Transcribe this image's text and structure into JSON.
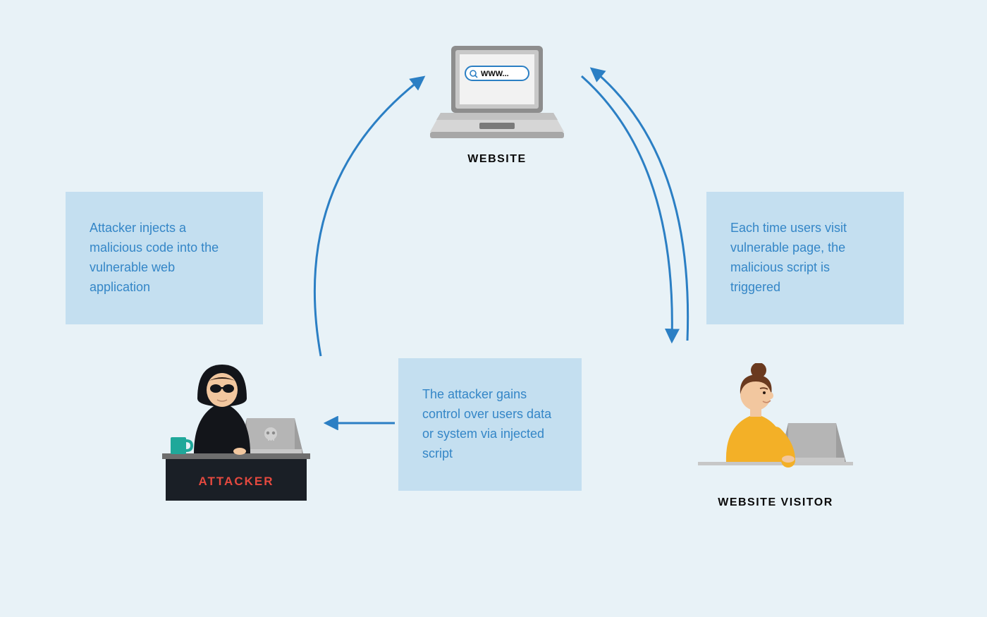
{
  "nodes": {
    "website_label": "WEBSITE",
    "website_url": "WWW...",
    "attacker_label": "ATTACKER",
    "visitor_label": "WEBSITE VISITOR"
  },
  "boxes": {
    "attacker_injects": "Attacker injects a malicious code into the vulnerable web application",
    "visitor_triggers": "Each time users visit vulnerable page, the malicious script is triggered",
    "attacker_gains": "The attacker gains control over users data or system via injected script"
  }
}
